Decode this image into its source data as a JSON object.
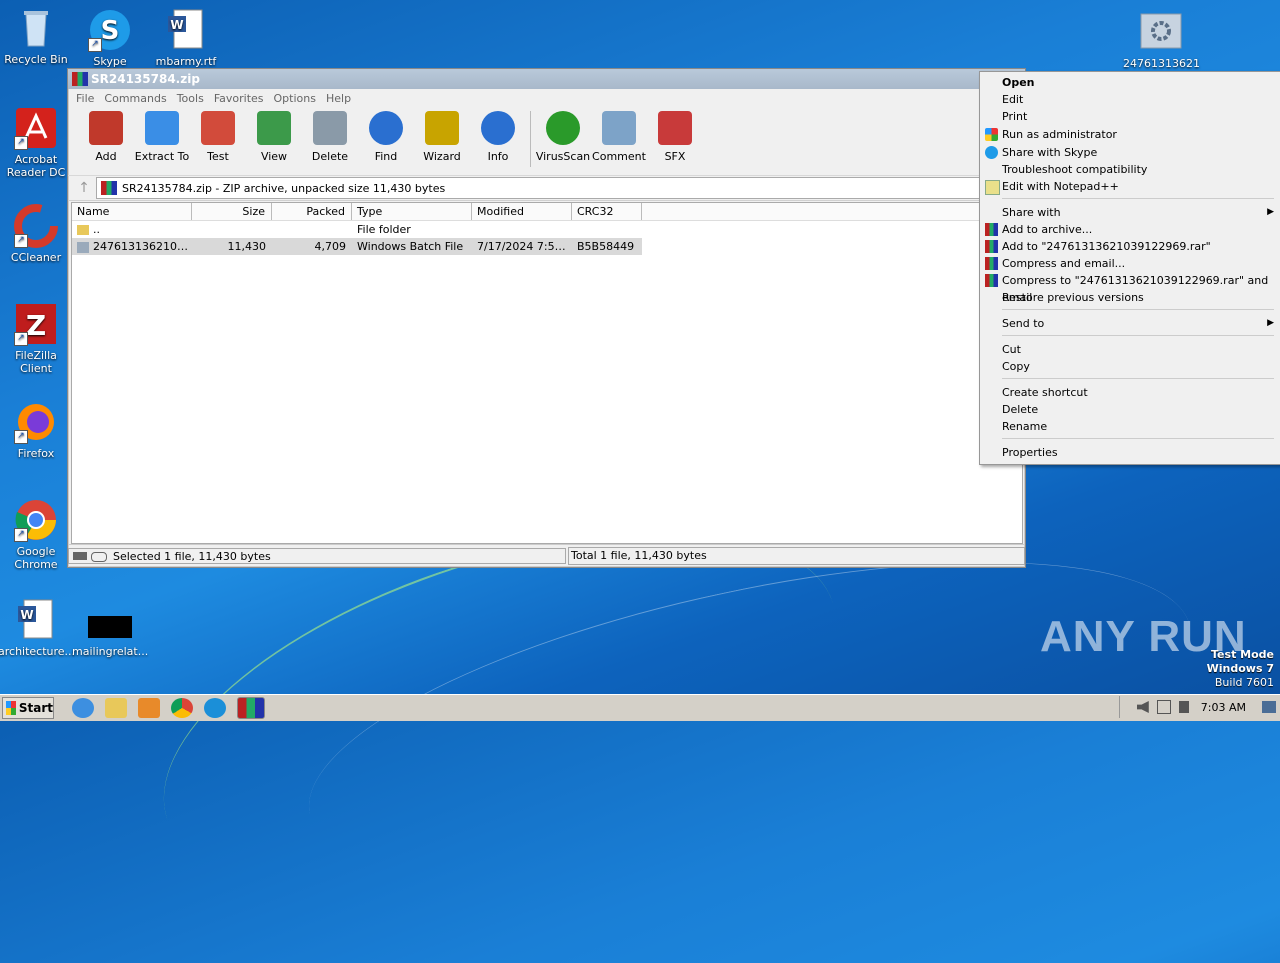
{
  "desktop": {
    "icons": [
      {
        "label": "Recycle Bin"
      },
      {
        "label": "Skype"
      },
      {
        "label": "mbarmy.rtf"
      },
      {
        "label": "Acrobat Reader DC"
      },
      {
        "label": "CCleaner"
      },
      {
        "label": "FileZilla Client"
      },
      {
        "label": "Firefox"
      },
      {
        "label": "Google Chrome"
      },
      {
        "label": "architecture..."
      },
      {
        "label": "mailingrelat..."
      },
      {
        "label": "24761313621"
      }
    ],
    "watermark": "ANY RUN",
    "os_info": {
      "line1": "Test Mode",
      "line2": "Windows 7",
      "line3": "Build 7601"
    }
  },
  "window": {
    "title": "SR24135784.zip",
    "menu": [
      "File",
      "Commands",
      "Tools",
      "Favorites",
      "Options",
      "Help"
    ],
    "toolbar": [
      {
        "label": "Add",
        "color": "#c0392b"
      },
      {
        "label": "Extract To",
        "color": "#3a8ee6"
      },
      {
        "label": "Test",
        "color": "#d24b3b"
      },
      {
        "label": "View",
        "color": "#3c9a4a"
      },
      {
        "label": "Delete",
        "color": "#8a9aa8"
      },
      {
        "label": "Find",
        "color": "#2a6fd0"
      },
      {
        "label": "Wizard",
        "color": "#c8a400"
      },
      {
        "label": "Info",
        "color": "#2a6fd0"
      },
      {
        "label": "VirusScan",
        "color": "#2a9a2a"
      },
      {
        "label": "Comment",
        "color": "#7da3c8"
      },
      {
        "label": "SFX",
        "color": "#c83a3a"
      }
    ],
    "address": "SR24135784.zip - ZIP archive, unpacked size 11,430 bytes",
    "columns": [
      "Name",
      "Size",
      "Packed",
      "Type",
      "Modified",
      "CRC32"
    ],
    "rows": [
      {
        "name": "..",
        "size": "",
        "packed": "",
        "type": "File folder",
        "modified": "",
        "crc": ""
      },
      {
        "name": "24761313621039...",
        "size": "11,430",
        "packed": "4,709",
        "type": "Windows Batch File",
        "modified": "7/17/2024 7:50...",
        "crc": "B5B58449"
      }
    ],
    "status_left": "Selected 1 file, 11,430 bytes",
    "status_right": "Total 1 file, 11,430 bytes"
  },
  "context_menu": {
    "items": [
      {
        "label": "Open",
        "bold": true
      },
      {
        "label": "Edit"
      },
      {
        "label": "Print"
      },
      {
        "label": "Run as administrator",
        "icon": "shield-icon"
      },
      {
        "label": "Share with Skype",
        "icon": "skype-icon"
      },
      {
        "label": "Troubleshoot compatibility"
      },
      {
        "label": "Edit with Notepad++",
        "icon": "notepadpp-icon"
      },
      {
        "label": "Share with",
        "submenu": true
      },
      {
        "label": "Add to archive...",
        "icon": "winrar-icon"
      },
      {
        "label": "Add to \"24761313621039122969.rar\"",
        "icon": "winrar-icon"
      },
      {
        "label": "Compress and email...",
        "icon": "winrar-icon"
      },
      {
        "label": "Compress to \"24761313621039122969.rar\" and email",
        "icon": "winrar-icon"
      },
      {
        "label": "Restore previous versions"
      },
      {
        "label": "Send to",
        "submenu": true
      },
      {
        "label": "Cut"
      },
      {
        "label": "Copy"
      },
      {
        "label": "Create shortcut"
      },
      {
        "label": "Delete"
      },
      {
        "label": "Rename"
      },
      {
        "label": "Properties"
      }
    ]
  },
  "taskbar": {
    "start_label": "Start",
    "clock": "7:03 AM"
  }
}
